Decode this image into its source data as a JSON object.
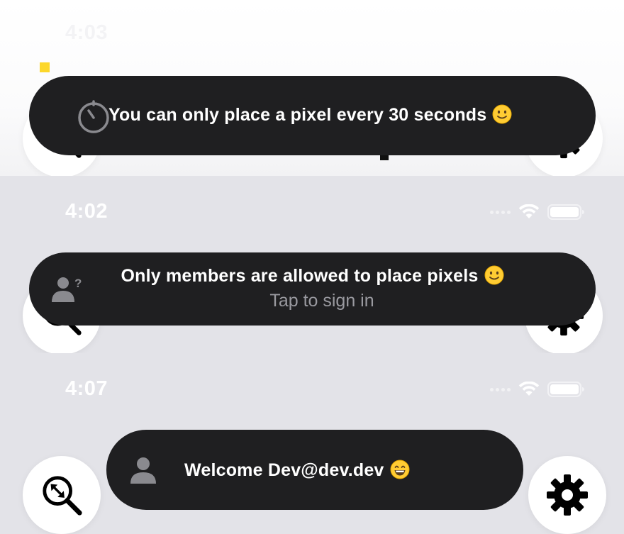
{
  "panels": [
    {
      "status": {
        "time": "4:03"
      },
      "toast": {
        "message": "You can only place a pixel every 30 seconds",
        "icon": "timer-icon",
        "emoji": "slightly-smiling-face"
      }
    },
    {
      "status": {
        "time": "4:02"
      },
      "toast": {
        "message": "Only members are allowed to place pixels",
        "subtext": "Tap to sign in",
        "icon": "person-question-icon",
        "emoji": "slightly-smiling-face"
      }
    },
    {
      "status": {
        "time": "4:07"
      },
      "toast": {
        "message": "Welcome Dev@dev.dev",
        "icon": "person-icon",
        "emoji": "grinning-face"
      }
    }
  ],
  "controls": {
    "zoom_icon": "zoom-icon",
    "settings_icon": "gear-icon"
  },
  "colors": {
    "toast_bg": "#1f1f21",
    "panel_bg": "#e3e3e8",
    "pixel_marker": "#fcd72b",
    "subtext": "#9a9aa0"
  }
}
